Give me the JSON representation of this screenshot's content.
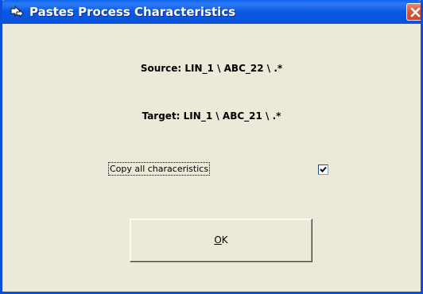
{
  "window": {
    "title": "Pastes Process Characteristics"
  },
  "content": {
    "source_text": "Source: LIN_1 \\ ABC_22 \\ .*",
    "target_text": "Target: LIN_1 \\ ABC_21 \\ .*",
    "copy_all_label": "Copy all characeristics",
    "copy_all_checked": true
  },
  "buttons": {
    "ok_mnemonic": "O",
    "ok_rest": "K"
  },
  "icons": {
    "title_icon": "paste-arrow-icon",
    "close_icon": "close-icon"
  },
  "colors": {
    "title_bar": "#0a58e6",
    "close_button": "#d85a3c",
    "dialog_background": "#ece9d8"
  }
}
